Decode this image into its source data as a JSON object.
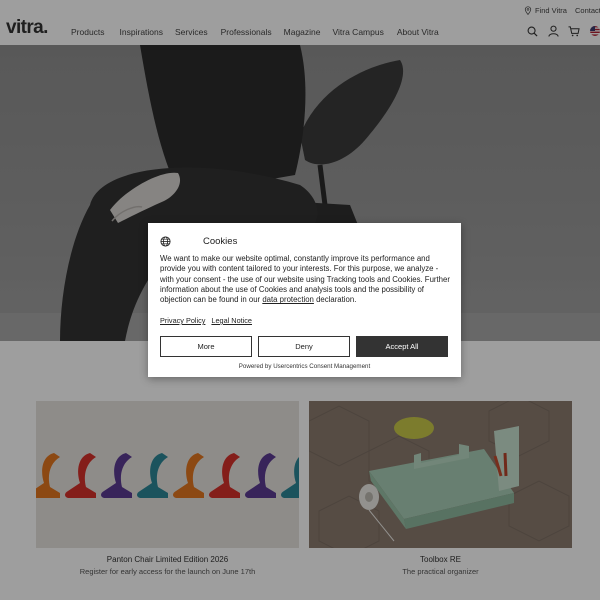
{
  "utility": {
    "find_label": "Find Vitra",
    "contact_label": "Contact"
  },
  "header": {
    "logo": "vitra.",
    "nav": [
      "Products",
      "Inspirations",
      "Services",
      "Professionals",
      "Magazine",
      "Vitra Campus",
      "About Vitra"
    ],
    "icons": [
      "search-icon",
      "account-icon",
      "cart-icon",
      "us-flag-icon"
    ]
  },
  "cards": [
    {
      "title": "Panton Chair Limited Edition 2026",
      "subtitle": "Register for early access for the launch on June 17th"
    },
    {
      "title": "Toolbox RE",
      "subtitle": "The practical organizer"
    }
  ],
  "cookie": {
    "title": "Cookies",
    "body_part1": "We want to make our website optimal, constantly improve its performance and provide you with content tailored to your interests. For this purpose, we analyze - with your consent - the use of our website using Tracking tools and Cookies. Further information about the use of Cookies and analysis tools and the possibility of objection can be found in our ",
    "body_link": "data protection",
    "body_part2": " declaration.",
    "privacy_link": "Privacy Policy",
    "legal_link": "Legal Notice",
    "btn_more": "More",
    "btn_deny": "Deny",
    "btn_accept": "Accept All",
    "powered": "Powered by Usercentrics Consent Management"
  },
  "colors": {
    "accept_bg": "#333333",
    "panton_colors": [
      "#e2761f",
      "#d6312b",
      "#5b3a92",
      "#2d8797"
    ]
  }
}
